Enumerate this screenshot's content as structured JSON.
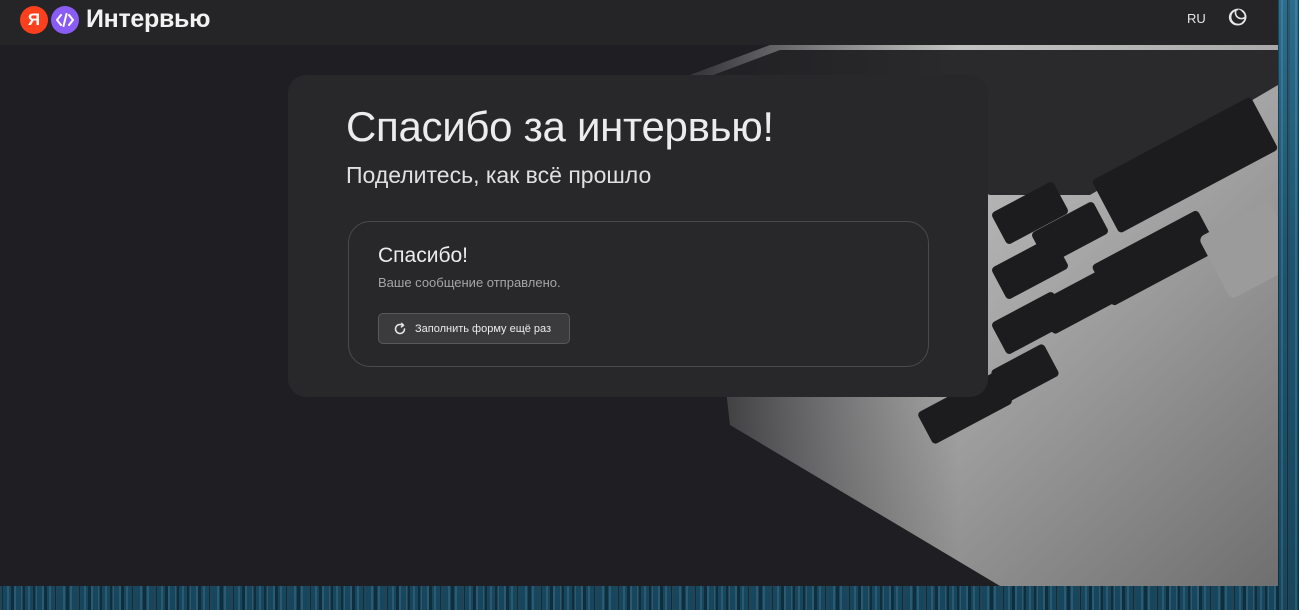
{
  "header": {
    "logo_letter": "Я",
    "logo_text": "Интервью",
    "language": "RU",
    "theme_icon": "moon-icon"
  },
  "card": {
    "title": "Спасибо за интервью!",
    "subtitle": "Поделитесь, как всё прошло",
    "result": {
      "title": "Спасибо!",
      "message": "Ваше сообщение отправлено.",
      "retry_label": "Заполнить форму ещё раз",
      "retry_icon": "refresh-icon"
    }
  },
  "colors": {
    "brand_red": "#fc3f1d",
    "brand_purple": "#8a5cf6",
    "page_bg": "#1f1f23",
    "card_bg": "#28282a"
  }
}
